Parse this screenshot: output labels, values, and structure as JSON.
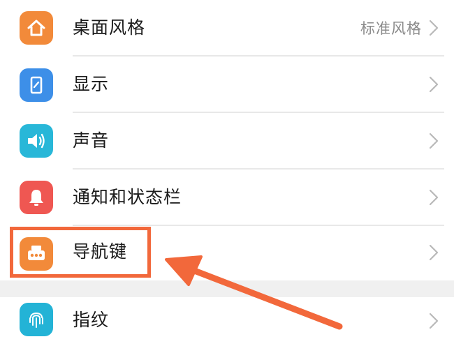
{
  "settings": {
    "items": [
      {
        "label": "桌面风格",
        "value": "标准风格",
        "icon": "home-icon",
        "color": "#f28a3a"
      },
      {
        "label": "显示",
        "value": "",
        "icon": "display-phone-icon",
        "color": "#3d8fe8"
      },
      {
        "label": "声音",
        "value": "",
        "icon": "speaker-icon",
        "color": "#28b7d8"
      },
      {
        "label": "通知和状态栏",
        "value": "",
        "icon": "bell-icon",
        "color": "#ef5752"
      },
      {
        "label": "导航键",
        "value": "",
        "icon": "navigation-key-icon",
        "color": "#f28a3a"
      },
      {
        "label": "指纹",
        "value": "",
        "icon": "fingerprint-icon",
        "color": "#23b3d6"
      }
    ]
  },
  "annotation": {
    "highlight_color": "#f2683b",
    "highlighted_item": "导航键"
  }
}
